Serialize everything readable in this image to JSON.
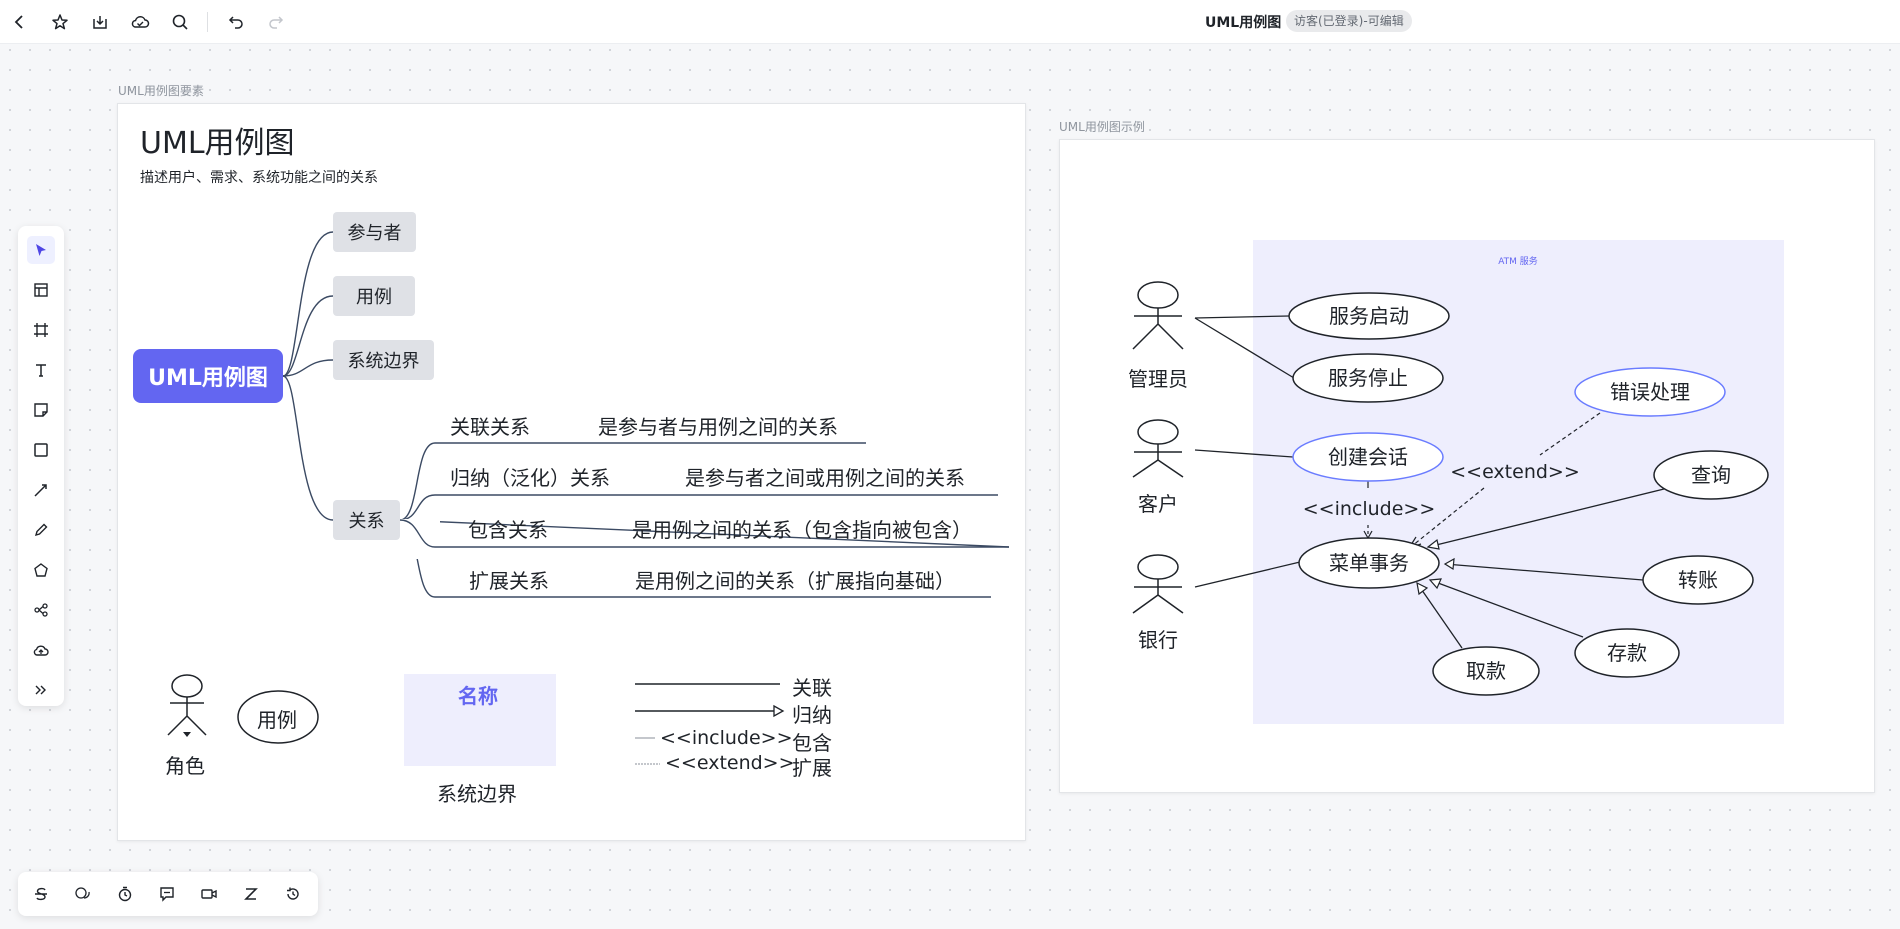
{
  "app": {
    "doc_title": "UML用例图",
    "access_badge": "访客(已登录)-可编辑"
  },
  "colors": {
    "accent": "#6366f1",
    "boundary_fill": "#eeeefd",
    "node_gray": "#dfe1e6",
    "selected_ellipse_border": "#6a7cff"
  },
  "toolbar_icons": [
    "back-icon",
    "star-icon",
    "download-icon",
    "cloud-icon",
    "search-icon",
    "undo-icon",
    "redo-icon"
  ],
  "frames": {
    "left_label": "UML用例图要素",
    "right_label": "UML用例图示例"
  },
  "mindmap": {
    "title": "UML用例图",
    "subtitle": "描述用户、需求、系统功能之间的关系",
    "root": "UML用例图",
    "children": [
      "参与者",
      "用例",
      "系统边界",
      "关系"
    ],
    "relations": [
      {
        "name": "关联关系",
        "desc": "是参与者与用例之间的关系"
      },
      {
        "name": "归纳（泛化）关系",
        "desc": "是参与者之间或用例之间的关系"
      },
      {
        "name": "包含关系",
        "desc": "是用例之间的关系（包含指向被包含）"
      },
      {
        "name": "扩展关系",
        "desc": "是用例之间的关系（扩展指向基础）"
      }
    ]
  },
  "legend": {
    "actor": "角色",
    "usecase": "用例",
    "boundary_name": "名称",
    "boundary": "系统边界",
    "assoc": "关联",
    "generalize": "归纳",
    "include_tag": "<<include>>",
    "include": "包含",
    "extend_tag": "<<extend>>",
    "extend": "扩展"
  },
  "example": {
    "boundary_title": "ATM 服务",
    "actors": [
      "管理员",
      "客户",
      "银行"
    ],
    "usecases": {
      "start": "服务启动",
      "stop": "服务停止",
      "session": "创建会话",
      "menu": "菜单事务",
      "error": "错误处理",
      "query": "查询",
      "transfer": "转账",
      "deposit": "存款",
      "withdraw": "取款"
    },
    "include_label": "<<include>>",
    "extend_label": "<<extend>>"
  },
  "left_tools": [
    "select-icon",
    "template-icon",
    "frame-icon",
    "text-icon",
    "sticky-note-icon",
    "rectangle-icon",
    "line-icon",
    "pen-icon",
    "polygon-icon",
    "mindmap-icon",
    "upload-icon",
    "more-icon"
  ],
  "bottom_tools": [
    "strike-icon",
    "comment-icon",
    "timer-icon",
    "chat-icon",
    "video-icon",
    "zoom-z-icon",
    "history-icon"
  ]
}
